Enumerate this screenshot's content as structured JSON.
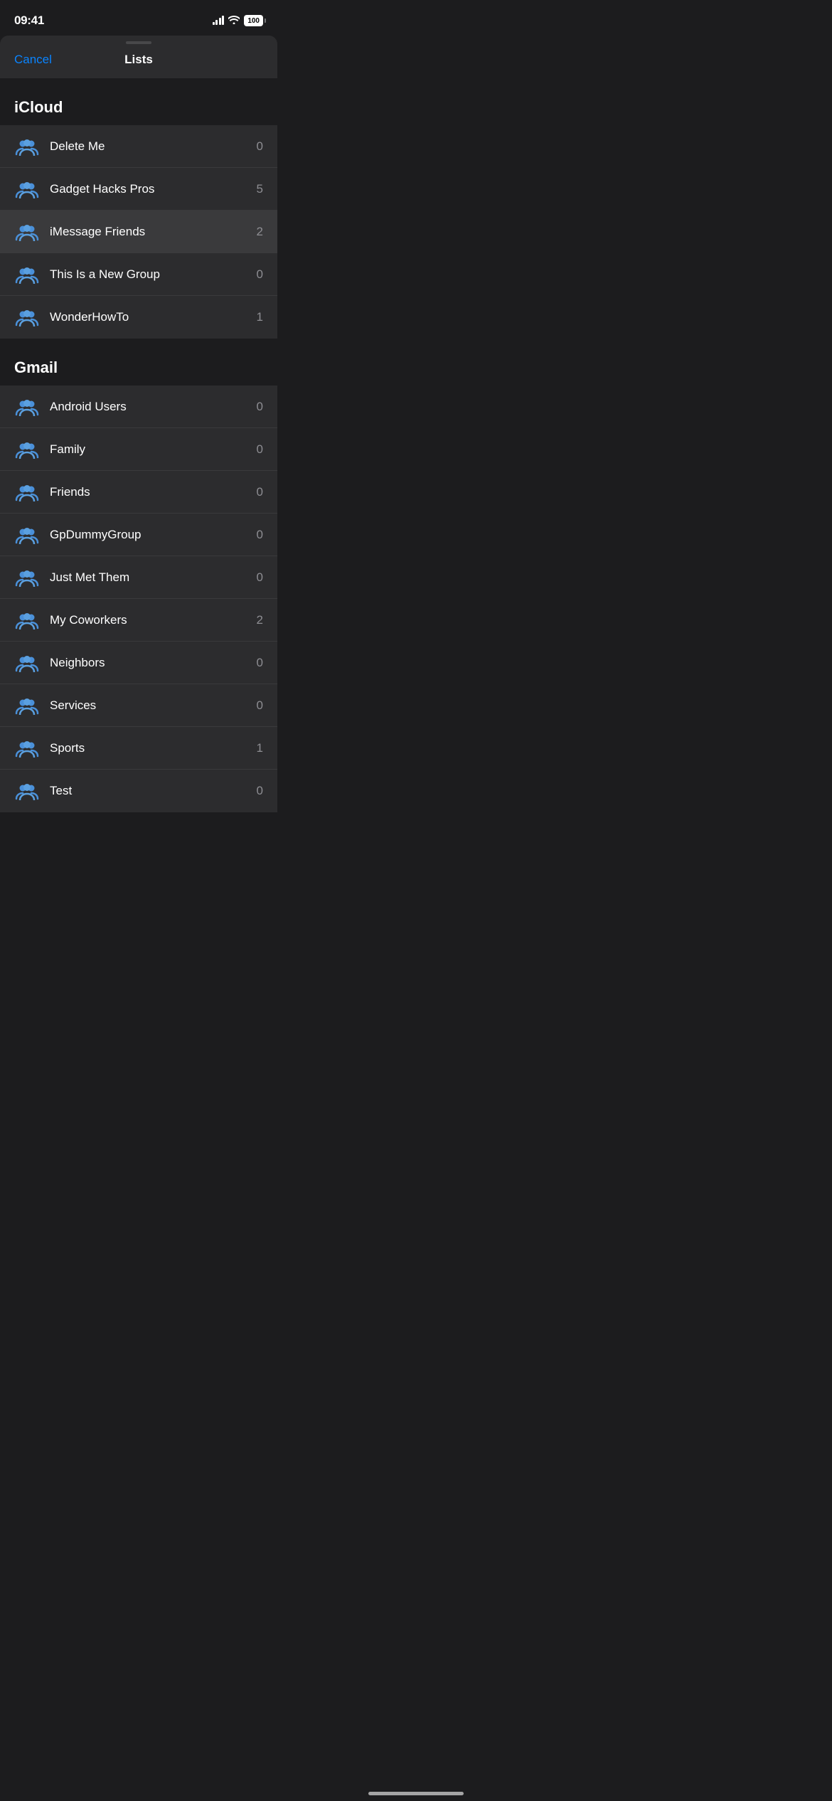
{
  "statusBar": {
    "time": "09:41",
    "battery": "100"
  },
  "header": {
    "cancelLabel": "Cancel",
    "title": "Lists"
  },
  "icloudSection": {
    "title": "iCloud",
    "items": [
      {
        "name": "Delete Me",
        "count": "0",
        "selected": false
      },
      {
        "name": "Gadget Hacks Pros",
        "count": "5",
        "selected": false
      },
      {
        "name": "iMessage Friends",
        "count": "2",
        "selected": true
      },
      {
        "name": "This Is a New Group",
        "count": "0",
        "selected": false
      },
      {
        "name": "WonderHowTo",
        "count": "1",
        "selected": false
      }
    ]
  },
  "gmailSection": {
    "title": "Gmail",
    "items": [
      {
        "name": "Android Users",
        "count": "0",
        "selected": false
      },
      {
        "name": "Family",
        "count": "0",
        "selected": false
      },
      {
        "name": "Friends",
        "count": "0",
        "selected": false
      },
      {
        "name": "GpDummyGroup",
        "count": "0",
        "selected": false
      },
      {
        "name": "Just Met Them",
        "count": "0",
        "selected": false
      },
      {
        "name": "My Coworkers",
        "count": "2",
        "selected": false
      },
      {
        "name": "Neighbors",
        "count": "0",
        "selected": false
      },
      {
        "name": "Services",
        "count": "0",
        "selected": false
      },
      {
        "name": "Sports",
        "count": "1",
        "selected": false
      },
      {
        "name": "Test",
        "count": "0",
        "selected": false
      }
    ]
  }
}
